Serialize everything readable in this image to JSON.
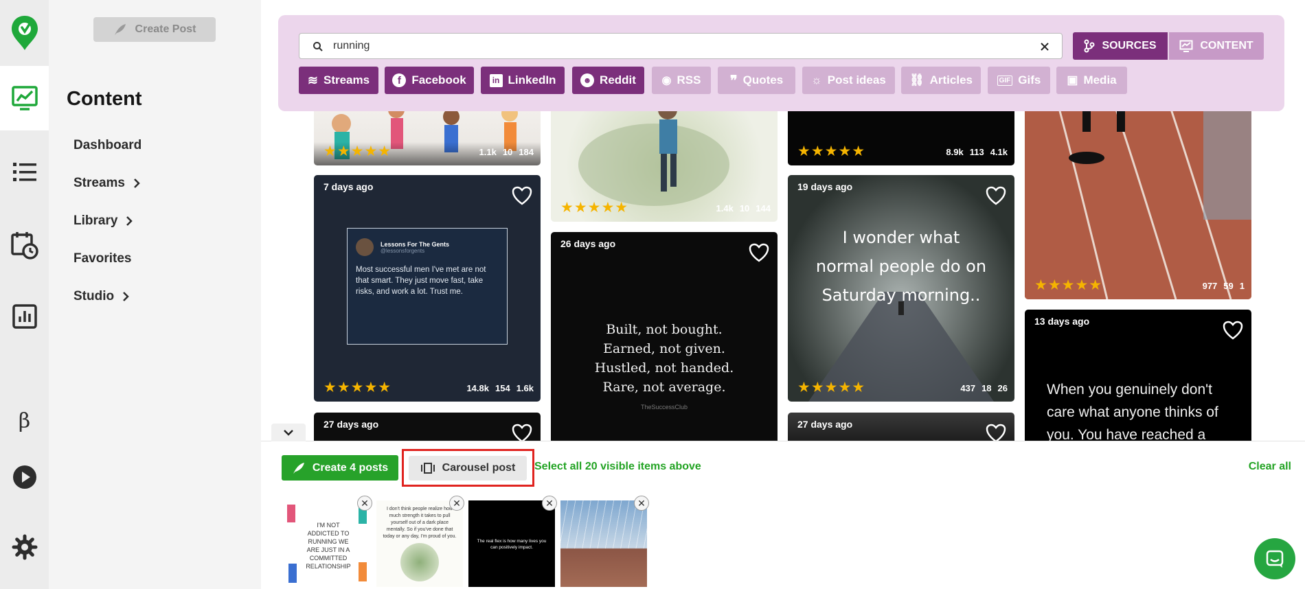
{
  "nav": {
    "create_post": "Create Post",
    "title": "Content",
    "items": [
      {
        "label": "Dashboard",
        "chevron": false
      },
      {
        "label": "Streams",
        "chevron": true
      },
      {
        "label": "Library",
        "chevron": true
      },
      {
        "label": "Favorites",
        "chevron": false
      },
      {
        "label": "Studio",
        "chevron": true
      }
    ]
  },
  "rail": {
    "beta": "β"
  },
  "search": {
    "query": "running",
    "sources_label": "SOURCES",
    "content_label": "CONTENT",
    "chips": [
      {
        "label": "Streams",
        "icon": "streams-icon",
        "active": true
      },
      {
        "label": "Facebook",
        "icon": "facebook-icon",
        "active": true
      },
      {
        "label": "LinkedIn",
        "icon": "linkedin-icon",
        "active": true
      },
      {
        "label": "Reddit",
        "icon": "reddit-icon",
        "active": true
      },
      {
        "label": "RSS",
        "icon": "rss-icon",
        "active": false
      },
      {
        "label": "Quotes",
        "icon": "quotes-icon",
        "active": false
      },
      {
        "label": "Post ideas",
        "icon": "lightbulb-icon",
        "active": false
      },
      {
        "label": "Articles",
        "icon": "link-icon",
        "active": false
      },
      {
        "label": "Gifs",
        "icon": "gif-icon",
        "active": false
      },
      {
        "label": "Media",
        "icon": "media-icon",
        "active": false
      }
    ]
  },
  "cards": {
    "c1": {
      "stars": "★★★★★",
      "likes": "1.1k",
      "comments": "10",
      "shares": "184"
    },
    "c2": {
      "stars": "★★★★★",
      "likes": "1.4k",
      "comments": "10",
      "shares": "144"
    },
    "c3": {
      "stars": "★★★★★",
      "likes": "8.9k",
      "comments": "113",
      "shares": "4.1k"
    },
    "c4": {
      "stars": "★★★★★",
      "likes": "977",
      "comments": "59",
      "shares": "1"
    },
    "c5": {
      "age": "7 days ago",
      "stars": "★★★★★",
      "likes": "14.8k",
      "comments": "154",
      "shares": "1.6k",
      "tweet_name": "Lessons For The Gents",
      "tweet_handle": "@lessonsforgents",
      "tweet_text": "Most successful men I've met are not that smart. They just move fast, take risks, and work a lot. Trust me."
    },
    "c6": {
      "age": "26 days ago",
      "lines": [
        "Built, not bought.",
        "Earned, not given.",
        "Hustled, not handed.",
        "Rare, not average."
      ],
      "credit": "TheSuccessClub"
    },
    "c7": {
      "age": "19 days ago",
      "stars": "★★★★★",
      "likes": "437",
      "comments": "18",
      "shares": "26",
      "text": "I wonder what normal people do on Saturday morning.."
    },
    "c8": {
      "age": "13 days ago",
      "text": "When you genuinely don't care what anyone thinks of you. You have reached a"
    },
    "c9": {
      "age": "27 days ago"
    },
    "c10": {
      "age": "27 days ago"
    }
  },
  "bottom": {
    "create_label": "Create 4 posts",
    "carousel_label": "Carousel post",
    "select_all": "Select all 20 visible items above",
    "clear_all": "Clear all",
    "thumbs": [
      {
        "text": "I'M NOT ADDICTED TO RUNNING WE ARE JUST IN A COMMITTED RELATIONSHIP"
      },
      {
        "text": "I don't think people realize how much strength it takes to pull yourself out of a dark place mentally. So if you've done that today or any day, I'm proud of you."
      },
      {
        "text": "The real flex is how many lives you can positively impact."
      },
      {
        "text": ""
      }
    ]
  },
  "colors": {
    "brand_green": "#27a22a",
    "purple": "#7b2f7b",
    "purple_light": "#d2b1d2",
    "panel": "#ecd6ec",
    "highlight": "#e0231f"
  }
}
